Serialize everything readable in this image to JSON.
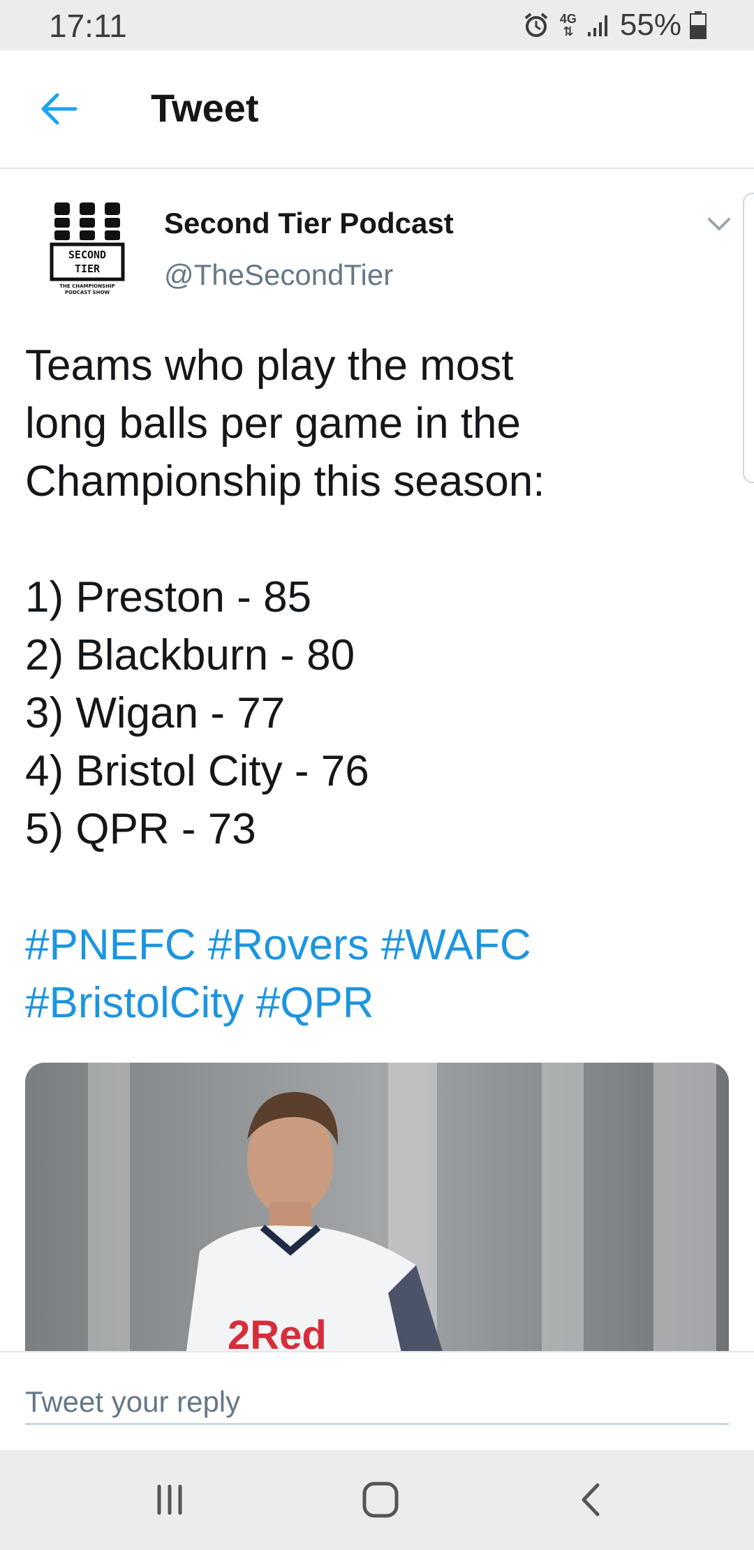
{
  "status_bar": {
    "time": "17:11",
    "network": "4G",
    "battery": "55%"
  },
  "header": {
    "title": "Tweet"
  },
  "tweet": {
    "author_name": "Second Tier Podcast",
    "handle": "@TheSecondTier",
    "avatar_logo_text": "SECOND TIER THE CHAMPIONSHIP PODCAST SHOW",
    "text_lines": [
      "Teams who play the most",
      "long balls per game in the",
      "Championship this season:"
    ],
    "list": [
      "1) Preston - 85",
      "2) Blackburn - 80",
      "3) Wigan - 77",
      "4) Bristol City - 76",
      "5) QPR - 73"
    ],
    "hashtag_lines": [
      "#PNEFC #Rovers #WAFC",
      "#BristolCity #QPR"
    ],
    "media_sponsor_text": "2Red"
  },
  "reply": {
    "placeholder": "Tweet your reply"
  },
  "colors": {
    "accent": "#1b95e0",
    "text": "#14171a",
    "secondary": "#657786",
    "status_bar_bg": "#ececec"
  },
  "icons": {
    "back": "arrow-left-icon",
    "more": "chevron-down-icon",
    "nav_recent": "recent-apps-icon",
    "nav_home": "home-icon",
    "nav_back": "nav-back-icon"
  }
}
